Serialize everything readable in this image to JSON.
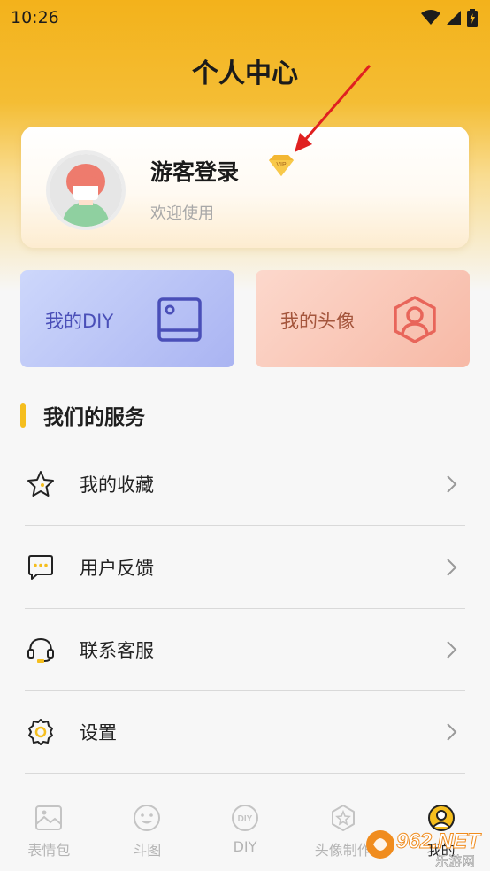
{
  "status_bar": {
    "time": "10:26"
  },
  "header": {
    "title": "个人中心"
  },
  "profile": {
    "name": "游客登录",
    "welcome": "欢迎使用",
    "vip_badge_text": "VIP"
  },
  "quick_actions": [
    {
      "label": "我的DIY",
      "icon": "image-frame-icon"
    },
    {
      "label": "我的头像",
      "icon": "user-hexagon-icon"
    }
  ],
  "services": {
    "title": "我们的服务",
    "items": [
      {
        "label": "我的收藏",
        "icon": "star-icon"
      },
      {
        "label": "用户反馈",
        "icon": "feedback-icon"
      },
      {
        "label": "联系客服",
        "icon": "headset-icon"
      },
      {
        "label": "设置",
        "icon": "gear-icon"
      }
    ]
  },
  "tab_bar": {
    "tabs": [
      {
        "label": "表情包",
        "icon": "image-icon"
      },
      {
        "label": "斗图",
        "icon": "smiley-icon"
      },
      {
        "label": "DIY",
        "icon": "diy-icon"
      },
      {
        "label": "头像制作",
        "icon": "badge-star-icon"
      },
      {
        "label": "我的",
        "icon": "user-circle-icon",
        "active": true
      }
    ]
  },
  "watermark": {
    "text": "962.NET",
    "subtext": "乐游网"
  },
  "colors": {
    "accent": "#f5be1e",
    "header_gradient_top": "#f3b21b",
    "diy_card": "#b9c3f6",
    "avatar_card": "#f9c8b8",
    "arrow": "#e02020"
  }
}
